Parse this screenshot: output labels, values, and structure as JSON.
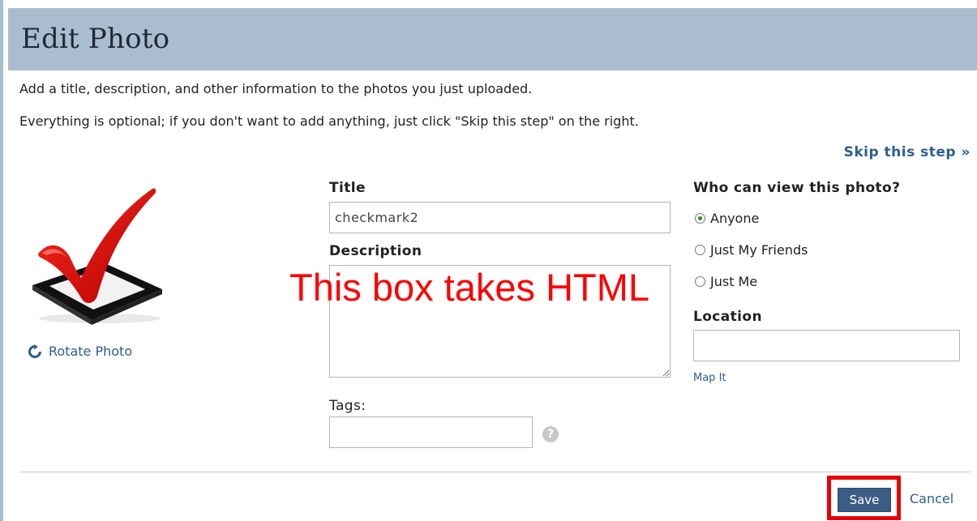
{
  "header": {
    "title": "Edit Photo"
  },
  "intro": {
    "line1": "Add a title, description, and other information to the photos you just uploaded.",
    "line2": "Everything is optional; if you don't want to add anything, just click \"Skip this step\" on the right."
  },
  "skip_link": "Skip this step »",
  "photo": {
    "rotate_label": "Rotate Photo"
  },
  "form": {
    "title_label": "Title",
    "title_value": "checkmark2",
    "description_label": "Description",
    "description_value": "",
    "tags_label": "Tags:",
    "tags_value": ""
  },
  "visibility": {
    "label": "Who can view this photo?",
    "options": [
      {
        "label": "Anyone",
        "checked": true
      },
      {
        "label": "Just My Friends",
        "checked": false
      },
      {
        "label": "Just Me",
        "checked": false
      }
    ]
  },
  "location": {
    "label": "Location",
    "value": "",
    "map_link": "Map It"
  },
  "annotation": "This box takes HTML",
  "actions": {
    "save_label": "Save",
    "cancel_label": "Cancel"
  },
  "colors": {
    "header_bg": "#aabccf",
    "link": "#2d5f8f",
    "annotation": "#ff0000",
    "save_bg": "#3b5d84"
  }
}
